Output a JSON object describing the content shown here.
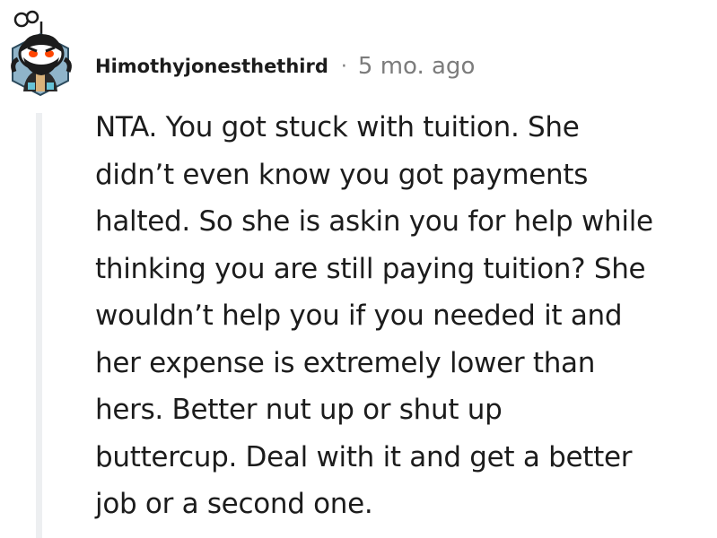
{
  "comment": {
    "author": "Himothyjonesthethird",
    "separator": "·",
    "timestamp": "5 mo. ago",
    "avatar_icon": "snoo-avatar-icon",
    "body_lines": [
      "NTA. You got stuck with tuition. She",
      "didn’t even know you got payments",
      "halted. So she is askin you for help while",
      "thinking you are still paying tuition? She",
      "wouldn’t help you if you needed it and",
      "her expense is extremely lower than",
      "hers. Better nut up or shut up",
      "buttercup. Deal with it and get a better",
      "job or a second one."
    ]
  },
  "colors": {
    "text": "#1c1c1c",
    "meta": "#7c7c7c",
    "thread_line": "#edeff1",
    "avatar_bg": "#8fb4c9",
    "avatar_accent": "#ff4500"
  }
}
